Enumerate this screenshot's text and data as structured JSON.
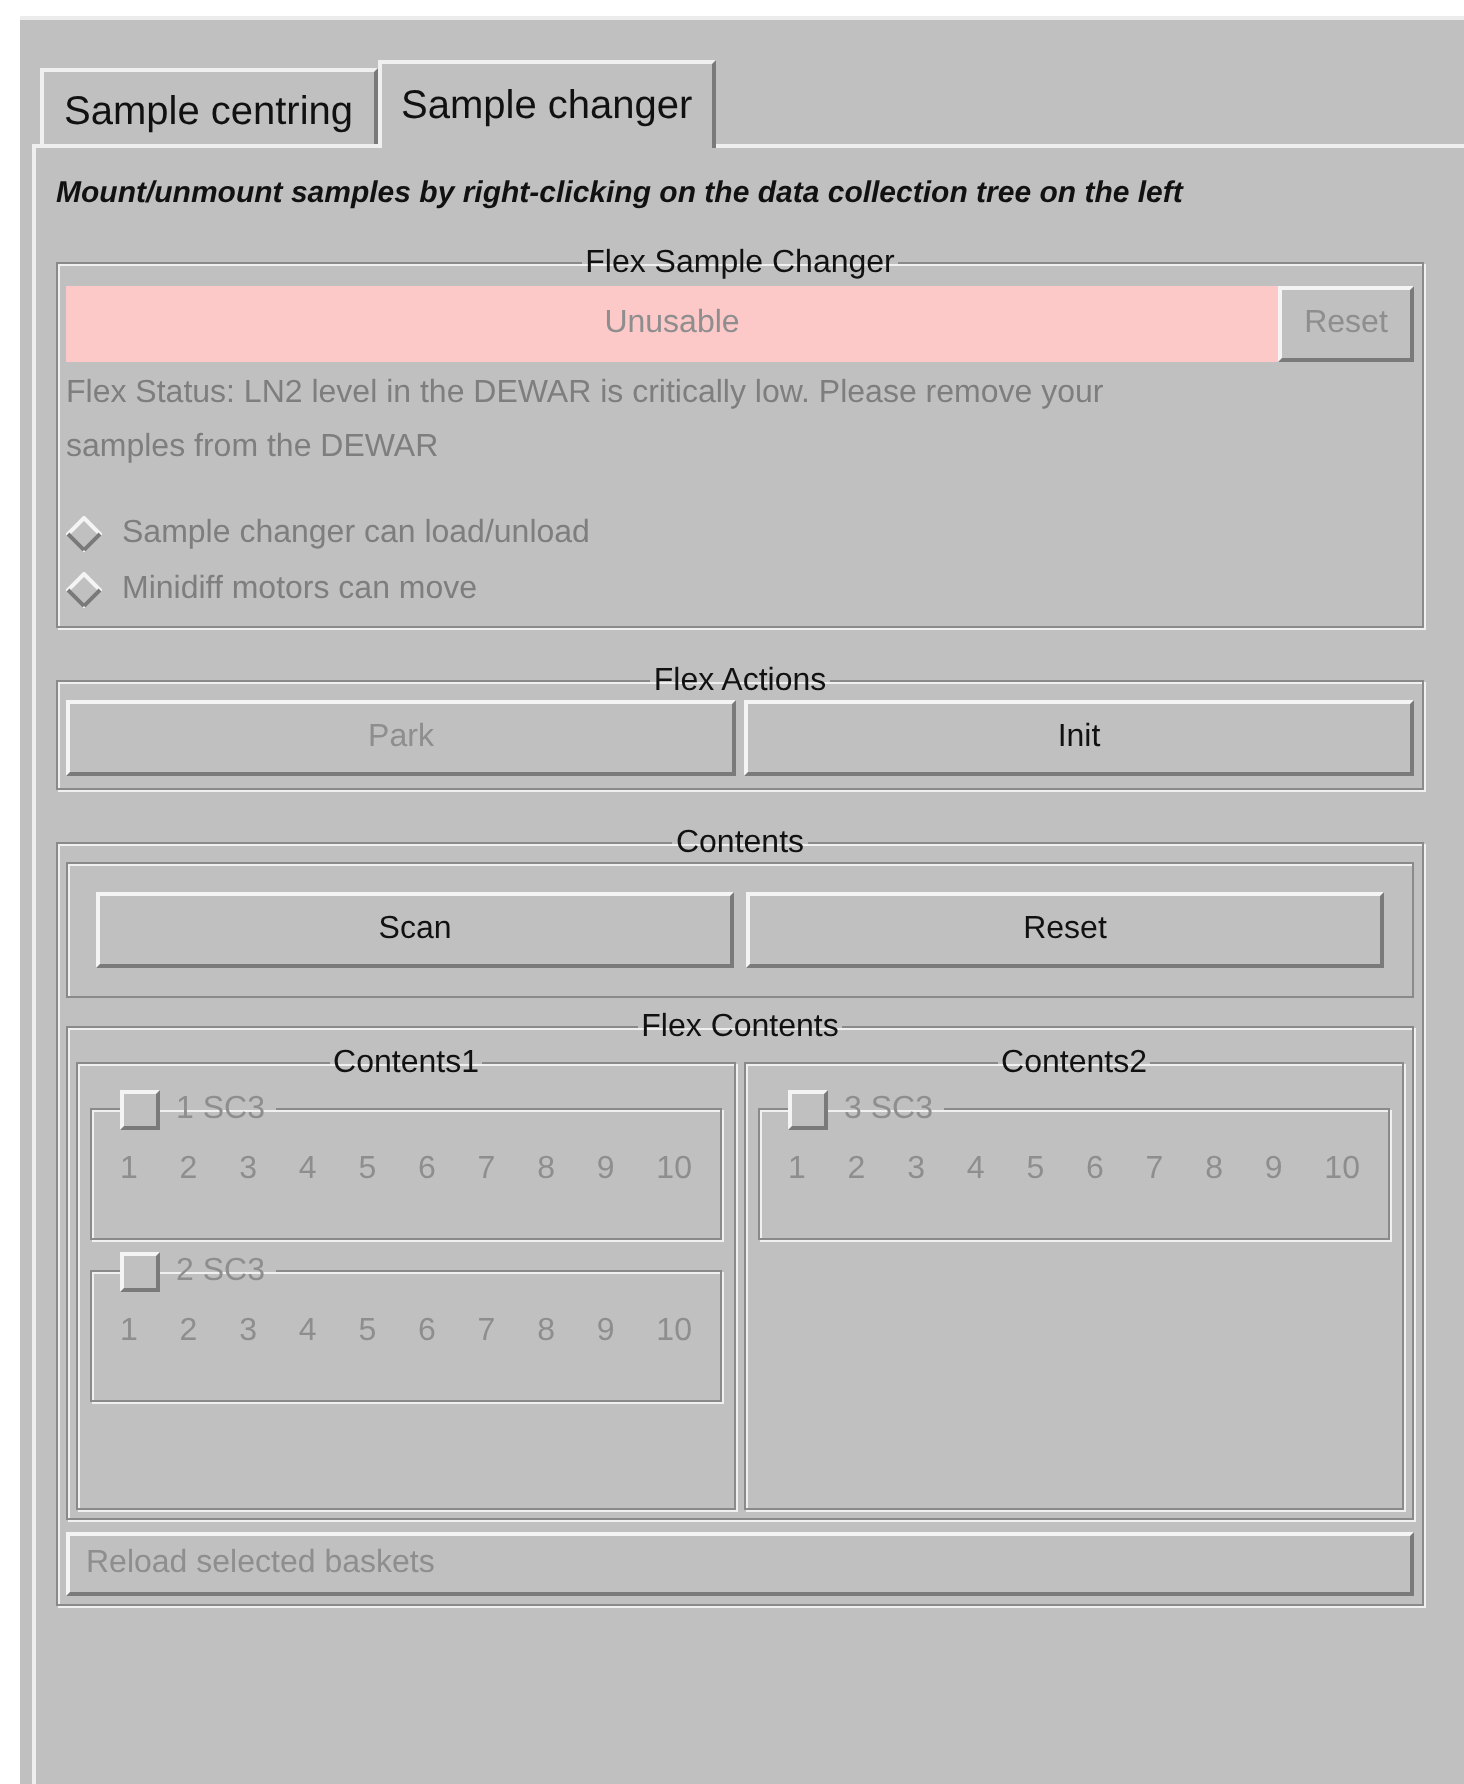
{
  "tabs": [
    {
      "label": "Sample centring",
      "selected": false
    },
    {
      "label": "Sample changer",
      "selected": true
    }
  ],
  "instruction": "Mount/unmount samples by right-clicking on the data collection tree on the left",
  "sample_changer": {
    "title": "Flex Sample Changer",
    "state": "Unusable",
    "reset_button": {
      "label": "Reset",
      "disabled": true
    },
    "status": "Flex Status: LN2 level in the DEWAR is critically low. Please remove your samples from the DEWAR",
    "indicators": [
      {
        "label": "Sample changer can load/unload",
        "on": false,
        "disabled": true
      },
      {
        "label": "Minidiff motors can move",
        "on": false,
        "disabled": true
      }
    ]
  },
  "actions": {
    "title": "Flex Actions",
    "buttons": [
      {
        "label": "Park",
        "disabled": true
      },
      {
        "label": "Init",
        "disabled": false
      }
    ]
  },
  "contents": {
    "title": "Contents",
    "buttons": [
      {
        "label": "Scan",
        "disabled": false
      },
      {
        "label": "Reset",
        "disabled": false
      }
    ],
    "flex_contents": {
      "title": "Flex Contents",
      "columns": [
        {
          "title": "Contents1",
          "baskets": [
            {
              "label": "1 SC3",
              "checked": false,
              "disabled": true,
              "slots": [
                "1",
                "2",
                "3",
                "4",
                "5",
                "6",
                "7",
                "8",
                "9",
                "10"
              ]
            },
            {
              "label": "2 SC3",
              "checked": false,
              "disabled": true,
              "slots": [
                "1",
                "2",
                "3",
                "4",
                "5",
                "6",
                "7",
                "8",
                "9",
                "10"
              ]
            }
          ]
        },
        {
          "title": "Contents2",
          "baskets": [
            {
              "label": "3 SC3",
              "checked": false,
              "disabled": true,
              "slots": [
                "1",
                "2",
                "3",
                "4",
                "5",
                "6",
                "7",
                "8",
                "9",
                "10"
              ]
            }
          ]
        }
      ]
    },
    "reload_button": {
      "label": "Reload selected baskets",
      "disabled": true
    }
  }
}
